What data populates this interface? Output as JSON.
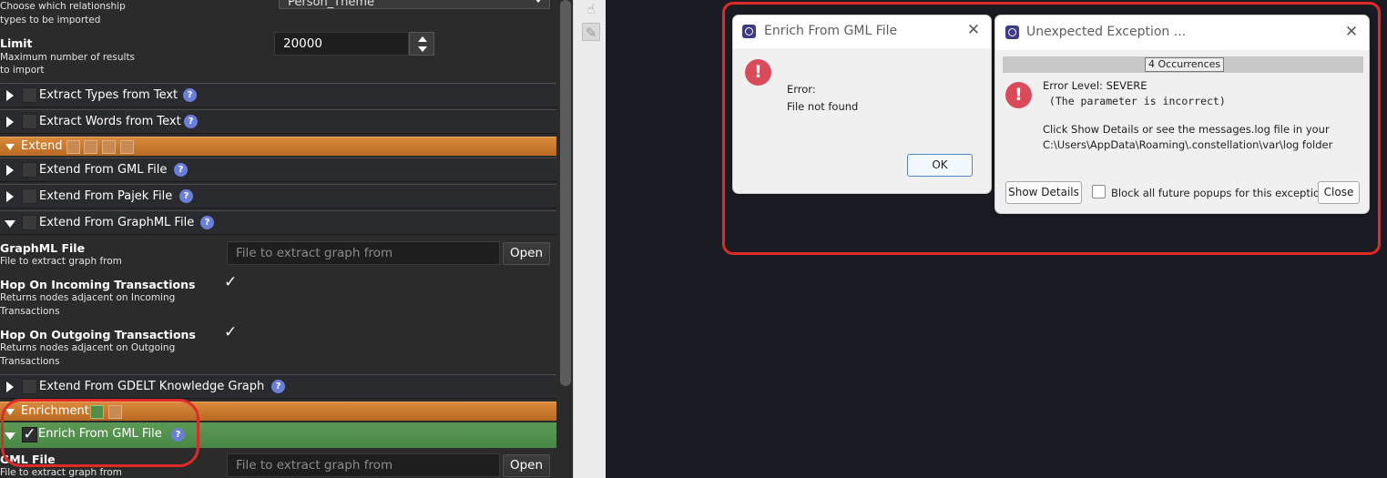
{
  "left_panel": {
    "relationship_types": {
      "desc_line1": "Choose which relationship",
      "desc_line2": "types to be imported",
      "dropdown_value": "Person_Theme"
    },
    "limit": {
      "name": "Limit",
      "desc_line1": "Maximum number of results",
      "desc_line2": "to import",
      "value": "20000"
    },
    "rows": {
      "extract_types": "Extract Types from Text",
      "extract_words": "Extract Words from Text",
      "extend_gml": "Extend From GML File",
      "extend_pajek": "Extend From Pajek File",
      "extend_graphml": "Extend From GraphML File",
      "extend_gdelt": "Extend From GDELT Knowledge Graph",
      "enrich_gml": "Enrich From GML File"
    },
    "categories": {
      "extend": "Extend",
      "enrichment": "Enrichment"
    },
    "graphml_file": {
      "name": "GraphML File",
      "desc": "File to extract graph from",
      "placeholder": "File to extract graph from",
      "button": "Open"
    },
    "hop_incoming": {
      "name": "Hop On Incoming Transactions",
      "desc_line1": "Returns nodes adjacent on Incoming",
      "desc_line2": "Transactions",
      "checked": true
    },
    "hop_outgoing": {
      "name": "Hop On Outgoing Transactions",
      "desc_line1": "Returns nodes adjacent on Outgoing",
      "desc_line2": "Transactions",
      "checked": true
    },
    "gml_file": {
      "name": "GML File",
      "desc": "File to extract graph from",
      "placeholder": "File to extract graph from",
      "button": "Open"
    },
    "help_glyph": "?"
  },
  "dialog_enrich": {
    "title": "Enrich From GML File",
    "close_glyph": "✕",
    "icon_glyph": "!",
    "line1": "Error:",
    "line2": "File  not found",
    "ok": "OK"
  },
  "dialog_exception": {
    "title": "Unexpected Exception ...",
    "close_glyph": "✕",
    "icon_glyph": "!",
    "occurrences": "4 Occurrences",
    "level": "Error Level: SEVERE",
    "message": " (The parameter is incorrect)",
    "hint_line1": "Click Show Details or see the messages.log file in your",
    "hint_line2": "C:\\Users\\AppData\\Roaming\\.constellation\\var\\log folder",
    "show_details": "Show Details",
    "block_label": "Block all future popups for this exception",
    "close": "Close"
  },
  "colors": {
    "category_orange": "#c97a2e",
    "enrich_green": "#4f8d49",
    "annotation_red": "#e02a2a",
    "help_blue": "#6a7fd9",
    "error_red": "#d94a5a"
  },
  "icons": {
    "dropdown": "chevron-down-icon",
    "spinner": "spinner-arrows-icon",
    "toolstrip_1": "hand-pointer-icon",
    "toolstrip_2": "pencil-icon"
  }
}
